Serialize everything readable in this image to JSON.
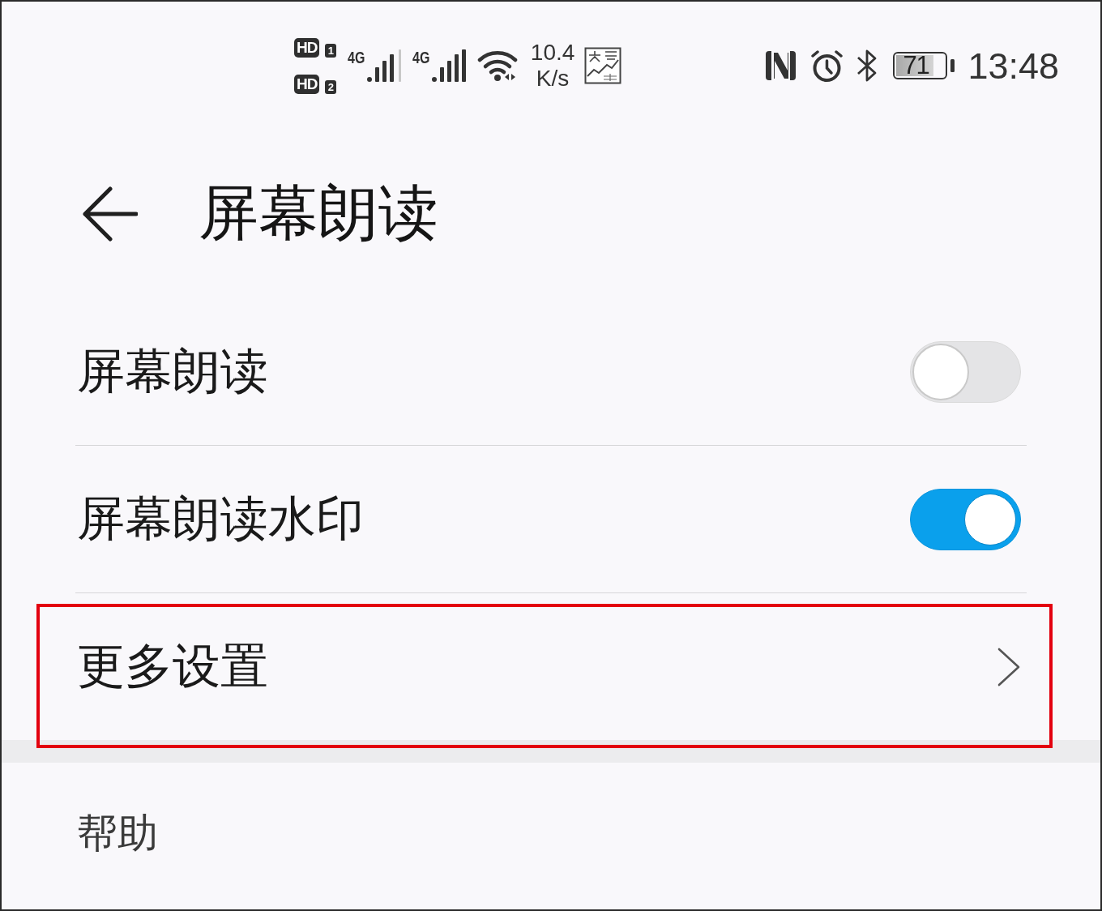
{
  "status_bar": {
    "sims": [
      {
        "badge": "HD",
        "slot": "1",
        "network": "4G"
      },
      {
        "badge": "HD",
        "slot": "2",
        "network": "4G"
      }
    ],
    "speed_value": "10.4",
    "speed_unit": "K/s",
    "battery_text": "71",
    "time": "13:48"
  },
  "header": {
    "title": "屏幕朗读"
  },
  "settings": {
    "items": [
      {
        "kind": "toggle",
        "label": "屏幕朗读",
        "on": false
      },
      {
        "kind": "toggle",
        "label": "屏幕朗读水印",
        "on": true
      },
      {
        "kind": "link",
        "label": "更多设置",
        "highlighted": true
      }
    ]
  },
  "help_section": {
    "title": "帮助"
  }
}
